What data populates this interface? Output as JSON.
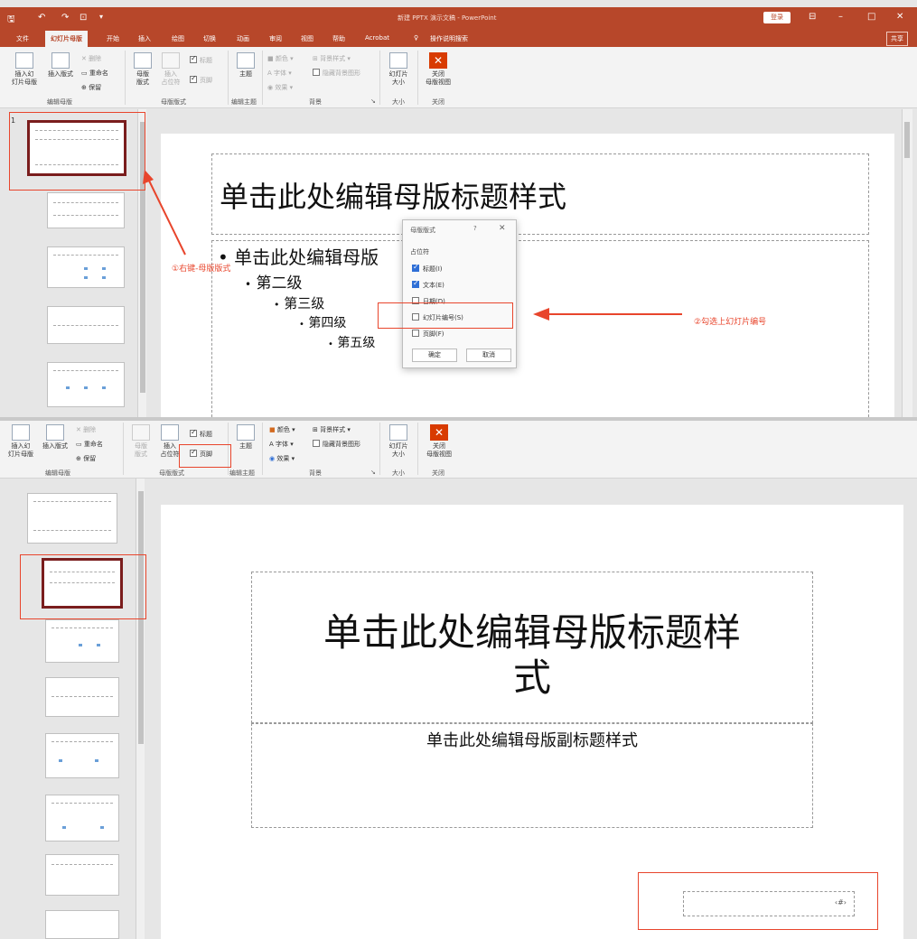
{
  "app": {
    "title": "新建 PPTX 演示文稿 - PowerPoint",
    "login_label": "登录",
    "share_label": "共享",
    "quick_access": [
      "save-icon",
      "undo-icon",
      "redo-icon",
      "customize-icon"
    ],
    "window_buttons": [
      "ribbon-display-icon",
      "minimize-icon",
      "maximize-icon",
      "close-icon"
    ]
  },
  "tabs": [
    "文件",
    "幻灯片母版",
    "开始",
    "插入",
    "绘图",
    "切换",
    "动画",
    "审阅",
    "视图",
    "帮助",
    "Acrobat"
  ],
  "tell_me": "操作说明搜索",
  "ribbon": {
    "insert_slide_master": "插入幻\n灯片母版",
    "insert_slide_master_b": "插入幻\n灯片母版",
    "insert_layout": "插入版式",
    "delete": "删除",
    "rename": "重命名",
    "preserve": "保留",
    "group_edit_master": "编辑母版",
    "master_layout": "母版\n版式",
    "insert_placeholder": "插入\n占位符",
    "title_check": "标题",
    "footer_check": "页脚",
    "group_master_layout": "母版版式",
    "theme": "主题",
    "group_edit_theme": "编辑主题",
    "colors": "颜色",
    "fonts": "字体",
    "effects": "效果",
    "bg_styles": "背景样式",
    "hide_bg": "隐藏背景图形",
    "group_background": "背景",
    "slide_size": "幻灯片\n大小",
    "group_size": "大小",
    "close_master": "关闭\n母版视图",
    "group_close": "关闭"
  },
  "top_slide": {
    "slide_number": "1",
    "title": "单击此处编辑母版标题样式",
    "levels": [
      "单击此处编辑母版",
      "第二级",
      "第三级",
      "第四级",
      "第五级"
    ],
    "bullet": "•"
  },
  "dialog": {
    "title": "母版版式",
    "help": "?",
    "close": "✕",
    "section": "占位符",
    "items": [
      {
        "label": "标题(I)",
        "checked": true
      },
      {
        "label": "文本(E)",
        "checked": true
      },
      {
        "label": "日期(D)",
        "checked": false
      },
      {
        "label": "幻灯片编号(S)",
        "checked": false
      },
      {
        "label": "页脚(F)",
        "checked": false
      }
    ],
    "ok": "确定",
    "cancel": "取消"
  },
  "annotations": {
    "step1": "①右键-母版版式",
    "step2": "②勾选上幻灯片编号"
  },
  "bottom_slide": {
    "title": "单击此处编辑母版标题样\n式",
    "subtitle": "单击此处编辑母版副标题样式",
    "page_number": "‹#›"
  },
  "checks": {
    "title_checked": true,
    "footer_checked": true
  }
}
